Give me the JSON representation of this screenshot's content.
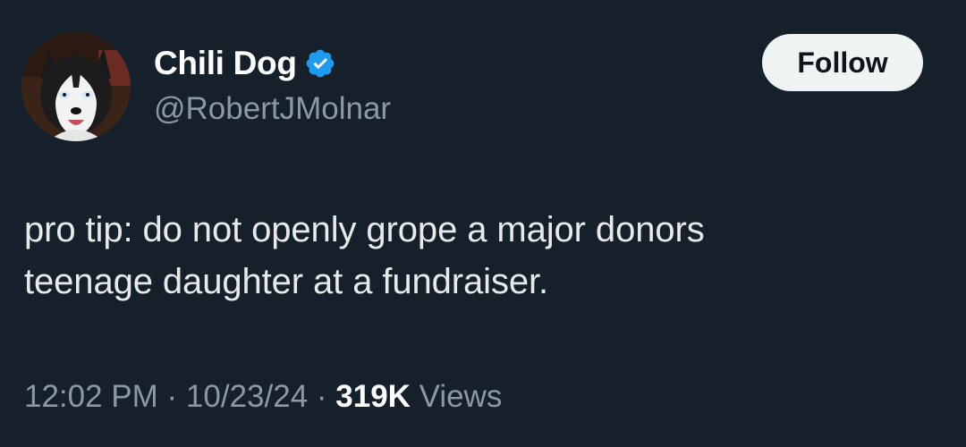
{
  "author": {
    "display_name": "Chili Dog",
    "handle": "@RobertJMolnar",
    "verified": true,
    "verified_icon": "verified-badge-icon",
    "avatar": "husky-dog-avatar"
  },
  "actions": {
    "follow_label": "Follow"
  },
  "tweet": {
    "text_line1": "pro tip: do not openly grope a major donors",
    "text_line2": "teenage daughter at a fundraiser."
  },
  "meta": {
    "time": "12:02 PM",
    "separator1": " · ",
    "date": "10/23/24",
    "separator2": " · ",
    "views_count": "319K",
    "views_label": " Views"
  },
  "colors": {
    "background": "#15202b",
    "verified_blue": "#1d9bf0",
    "secondary_text": "#8b98a5",
    "primary_text": "#e7e9ea",
    "follow_button_bg": "#eff3f4"
  }
}
